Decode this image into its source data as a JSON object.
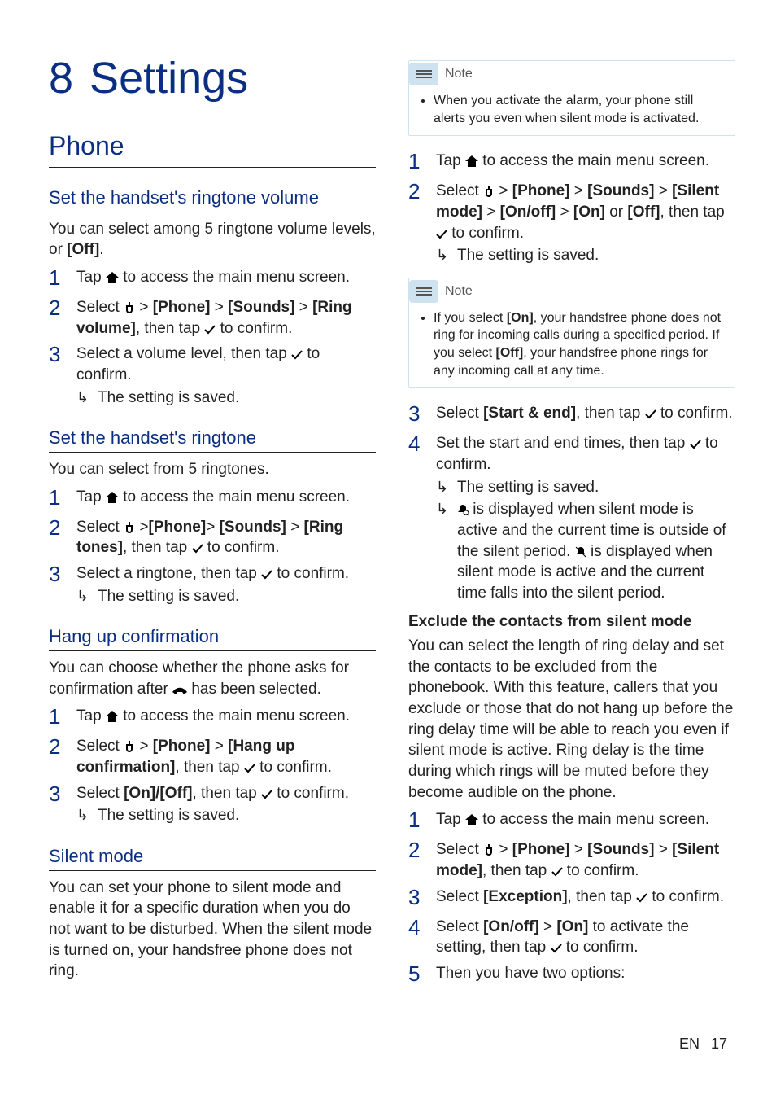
{
  "chapter": {
    "number": "8",
    "title": "Settings"
  },
  "phone": {
    "heading": "Phone",
    "ringtone_volume": {
      "heading": "Set the handset's ringtone volume",
      "intro": "You can select among 5 ringtone volume levels, or ",
      "intro_bold": "[Off]",
      "intro_tail": ".",
      "step1": "Tap ",
      "step1_tail": " to access the main menu screen.",
      "step2_a": "Select ",
      "step2_b": " > ",
      "step2_phone": "[Phone]",
      "step2_c": " > ",
      "step2_sounds": "[Sounds]",
      "step2_d": " > ",
      "step2_ring": "[Ring volume]",
      "step2_e": ", then tap ",
      "step2_f": " to confirm.",
      "step3_a": "Select a volume level, then tap ",
      "step3_b": " to confirm.",
      "result": "The setting is saved."
    },
    "ringtone": {
      "heading": "Set the handset's ringtone",
      "intro": "You can select from 5 ringtones.",
      "step1": "Tap ",
      "step1_tail": " to access the main menu screen.",
      "step2_a": "Select ",
      "step2_b": " >",
      "step2_phone": "[Phone]",
      "step2_c": "> ",
      "step2_sounds": "[Sounds]",
      "step2_d": " > ",
      "step2_ring": "[Ring tones]",
      "step2_e": ", then tap ",
      "step2_f": " to confirm.",
      "step3_a": "Select a ringtone, then tap ",
      "step3_b": " to confirm.",
      "result": "The setting is saved."
    },
    "hangup": {
      "heading": "Hang up confirmation",
      "intro_a": "You can choose whether the phone asks for confirmation after ",
      "intro_b": " has been selected.",
      "step1": "Tap ",
      "step1_tail": " to access the main menu screen.",
      "step2_a": "Select ",
      "step2_b": " > ",
      "step2_phone": "[Phone]",
      "step2_c": " > ",
      "step2_hang": "[Hang up confirmation]",
      "step2_d": ", then tap ",
      "step2_e": " to confirm.",
      "step3_a": "Select ",
      "step3_onoff": "[On]/[Off]",
      "step3_b": ", then tap ",
      "step3_c": " to confirm.",
      "result": "The setting is saved."
    },
    "silent": {
      "heading": "Silent mode",
      "intro": "You can set your phone to silent mode and enable it for a specific duration when you do not want to be disturbed. When the silent mode is turned on, your handsfree phone does not ring."
    }
  },
  "right": {
    "note1_label": "Note",
    "note1_body": "When you activate the alarm, your phone still alerts you even when silent mode is activated.",
    "step1": "Tap ",
    "step1_tail": " to access the main menu screen.",
    "step2_a": "Select ",
    "step2_b": " > ",
    "step2_phone": "[Phone]",
    "step2_c": " > ",
    "step2_sounds": "[Sounds]",
    "step2_d": " > ",
    "step2_silent": "[Silent mode]",
    "step2_e": " > ",
    "step2_onoff": "[On/off]",
    "step2_f": " > ",
    "step2_on": "[On]",
    "step2_g": " or ",
    "step2_off": "[Off]",
    "step2_h": ", then tap ",
    "step2_i": " to confirm.",
    "result1": "The setting is saved.",
    "note2_label": "Note",
    "note2_a": "If you select ",
    "note2_on": "[On]",
    "note2_b": ", your handsfree phone does not ring for incoming calls during a specified period. If you select ",
    "note2_off": "[Off]",
    "note2_c": ", your handsfree phone rings for any incoming call at any time.",
    "step3_a": "Select ",
    "step3_se": "[Start & end]",
    "step3_b": ", then tap ",
    "step3_c": " to confirm.",
    "step4_a": "Set the start and end times, then tap ",
    "step4_b": " to confirm.",
    "result4a": "The setting is saved.",
    "result4b_a": "",
    "result4b_mid": " is displayed when silent mode is active and the current time is outside of the silent period. ",
    "result4b_tail": " is displayed when silent mode is active and the current time falls into the silent period.",
    "exclude_head": "Exclude the contacts from silent mode",
    "exclude_para": "You can select the length of ring delay and set the contacts to be excluded from the phonebook. With this feature, callers that you exclude or those that do not hang up before the ring delay time will be able to reach you even if silent mode is active. Ring delay is the time during which rings will be muted before they become audible on the phone.",
    "ex1": "Tap ",
    "ex1_tail": " to access the main menu screen.",
    "ex2_a": "Select ",
    "ex2_b": " > ",
    "ex2_phone": "[Phone]",
    "ex2_c": " > ",
    "ex2_sounds": "[Sounds]",
    "ex2_d": " > ",
    "ex2_silent": "[Silent mode]",
    "ex2_e": ", then tap ",
    "ex2_f": " to confirm.",
    "ex3_a": "Select ",
    "ex3_exc": "[Exception]",
    "ex3_b": ", then tap ",
    "ex3_c": " to confirm.",
    "ex4_a": "Select ",
    "ex4_onoff": "[On/off]",
    "ex4_b": " > ",
    "ex4_on": "[On]",
    "ex4_c": " to activate the setting, then tap ",
    "ex4_d": " to confirm.",
    "ex5": "Then you have two options:"
  },
  "footer": {
    "lang": "EN",
    "page": "17"
  }
}
